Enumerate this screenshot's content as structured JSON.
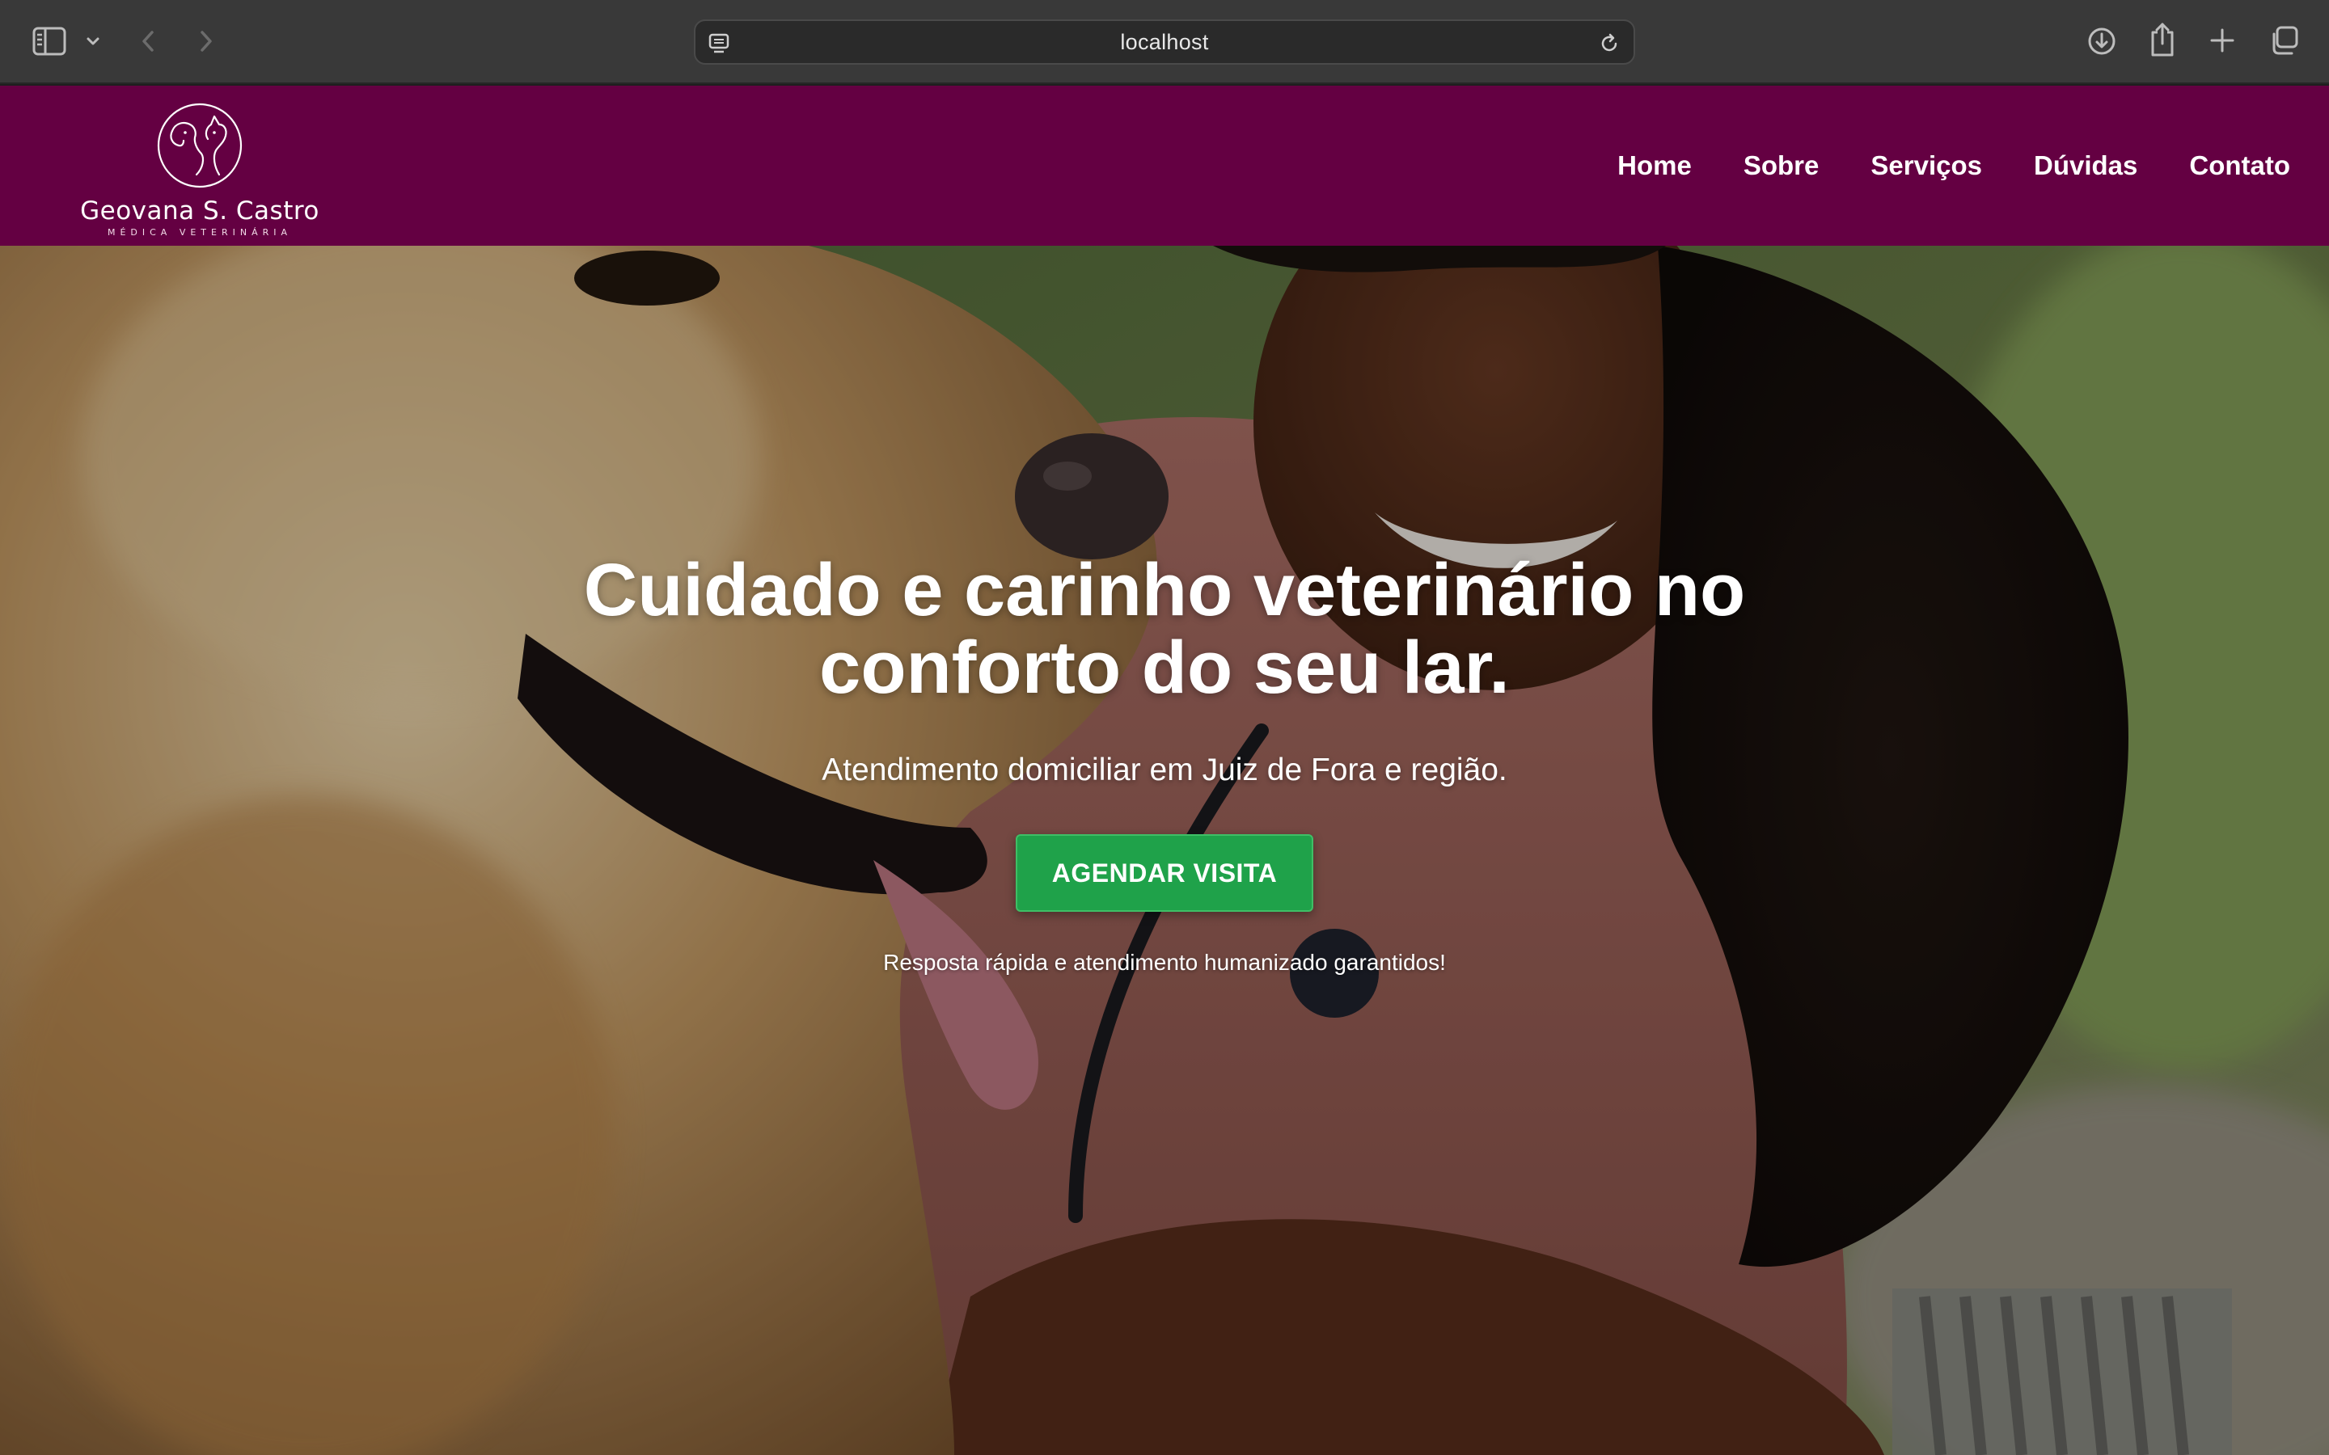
{
  "browser": {
    "url": "localhost",
    "icons": [
      "sidebar-icon",
      "chevron-down-icon",
      "back-arrow-icon",
      "forward-arrow-icon",
      "page-icon",
      "reload-icon",
      "download-icon",
      "share-icon",
      "plus-icon",
      "tabs-icon"
    ]
  },
  "header": {
    "background_color": "#640042",
    "brand": {
      "name": "Geovana S. Castro",
      "subtitle": "MÉDICA VETERINÁRIA",
      "logo_icon": "dog-cat-logo-icon"
    },
    "nav": {
      "items": [
        {
          "label": "Home"
        },
        {
          "label": "Sobre"
        },
        {
          "label": "Serviços"
        },
        {
          "label": "Dúvidas"
        },
        {
          "label": "Contato"
        }
      ]
    }
  },
  "hero": {
    "title": "Cuidado e carinho veterinário no conforto do seu lar.",
    "subtitle": "Atendimento domiciliar em Juiz de Fora e região.",
    "cta_label": "AGENDAR VISITA",
    "cta_color": "#1fa24a",
    "note": "Resposta rápida e atendimento humanizado garantidos!"
  }
}
